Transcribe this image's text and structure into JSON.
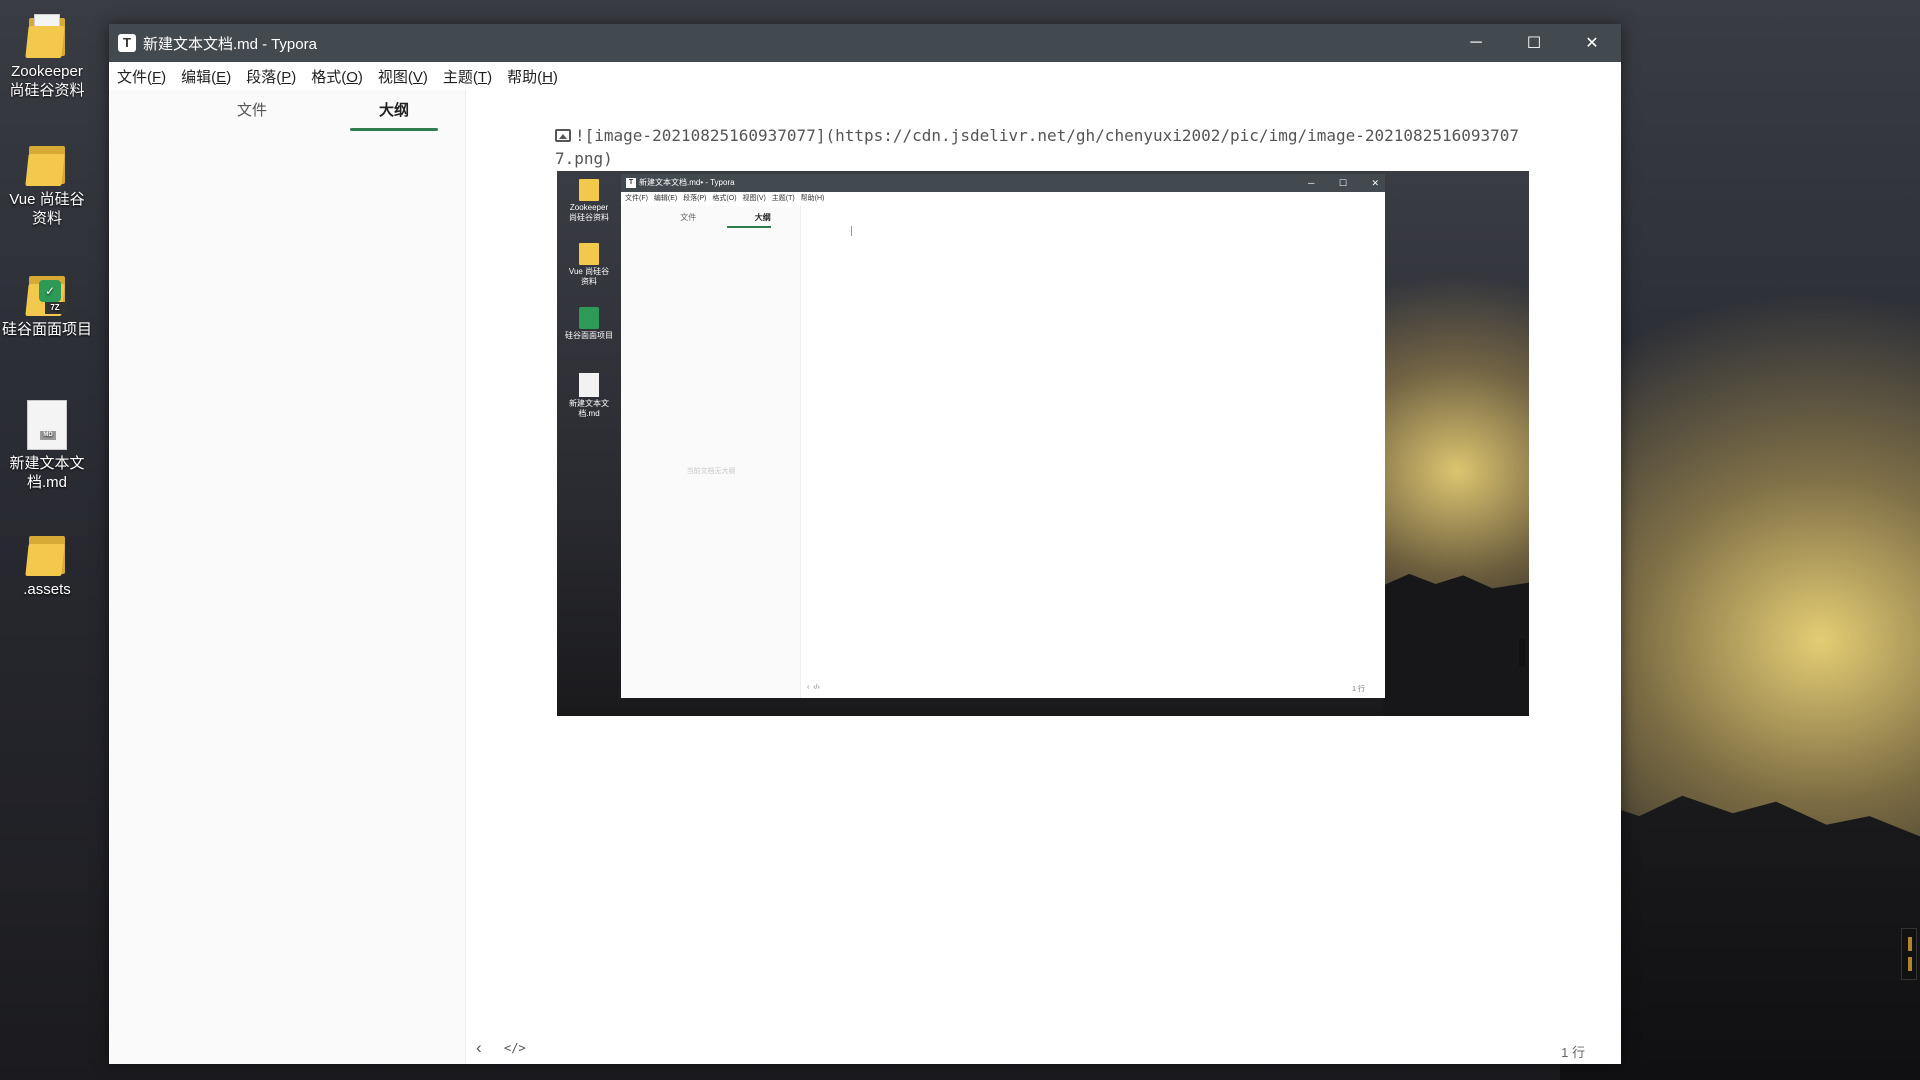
{
  "desktop": {
    "icons": [
      {
        "label": "Zookeeper\n尚硅谷资料",
        "icon": "folder-icon"
      },
      {
        "label": "Vue 尚硅谷\n资料",
        "icon": "folder-icon"
      },
      {
        "label": "硅谷面面项目",
        "icon": "archive-icon"
      },
      {
        "label": "新建文本文\n档.md",
        "icon": "markdown-file-icon"
      },
      {
        "label": ".assets",
        "icon": "folder-icon"
      }
    ]
  },
  "window": {
    "title": "新建文本文档.md - Typora",
    "app_icon_letter": "T",
    "controls": {
      "minimize": "─",
      "maximize": "☐",
      "close": "✕"
    }
  },
  "menu": [
    {
      "text": "文件(",
      "key": "F",
      "end": ")"
    },
    {
      "text": "编辑(",
      "key": "E",
      "end": ")"
    },
    {
      "text": "段落(",
      "key": "P",
      "end": ")"
    },
    {
      "text": "格式(",
      "key": "O",
      "end": ")"
    },
    {
      "text": "视图(",
      "key": "V",
      "end": ")"
    },
    {
      "text": "主题(",
      "key": "T",
      "end": ")"
    },
    {
      "text": "帮助(",
      "key": "H",
      "end": ")"
    }
  ],
  "sidebar": {
    "tabs": [
      {
        "label": "文件",
        "active": false
      },
      {
        "label": "大纲",
        "active": true
      }
    ],
    "accent": "#2f7d4f"
  },
  "editor": {
    "markdown_line": "![image-20210825160937077](https://cdn.jsdelivr.net/gh/chenyuxi2002/pic/img/image-20210825160937077.png)"
  },
  "embedded_screenshot": {
    "window_title": "新建文本文档.md• - Typora",
    "menu_text": "文件(F) 编辑(E) 段落(P) 格式(O) 视图(V) 主题(T) 帮助(H)",
    "tab_files": "文件",
    "tab_outline": "大纲",
    "empty_outline": "当前文档无大纲",
    "desktop_labels": [
      "Zookeeper\n尚硅谷资料",
      "Vue 尚硅谷\n资料",
      "硅谷面面项目",
      "新建文本文\n档.md"
    ],
    "word_count": "1 行"
  },
  "footer": {
    "word_count": "1 行"
  }
}
